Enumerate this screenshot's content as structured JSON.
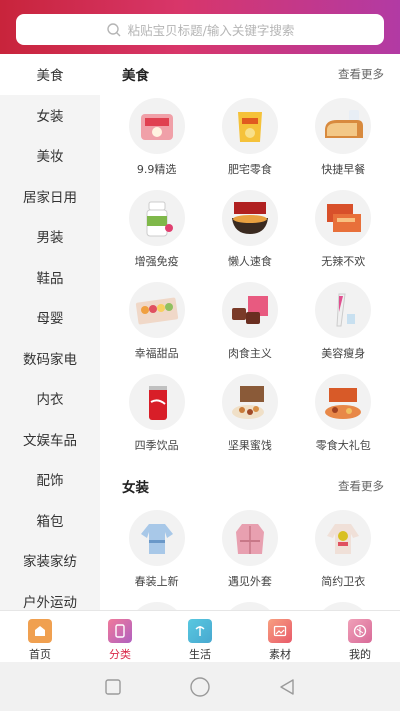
{
  "search": {
    "placeholder": "粘贴宝贝标题/输入关键字搜索"
  },
  "sidebar": {
    "items": [
      {
        "label": "美食",
        "active": true
      },
      {
        "label": "女装"
      },
      {
        "label": "美妆"
      },
      {
        "label": "居家日用"
      },
      {
        "label": "男装"
      },
      {
        "label": "鞋品"
      },
      {
        "label": "母婴"
      },
      {
        "label": "数码家电"
      },
      {
        "label": "内衣"
      },
      {
        "label": "文娱车品"
      },
      {
        "label": "配饰"
      },
      {
        "label": "箱包"
      },
      {
        "label": "家装家纺"
      },
      {
        "label": "户外运动"
      }
    ]
  },
  "sections": [
    {
      "title": "美食",
      "more": "查看更多",
      "items": [
        {
          "label": "9.9精选",
          "icon": "snack-bag-icon"
        },
        {
          "label": "肥宅零食",
          "icon": "chips-icon"
        },
        {
          "label": "快捷早餐",
          "icon": "bread-icon"
        },
        {
          "label": "增强免疫",
          "icon": "vitamin-bottle-icon"
        },
        {
          "label": "懒人速食",
          "icon": "noodle-bowl-icon"
        },
        {
          "label": "无辣不欢",
          "icon": "spicy-meat-icon"
        },
        {
          "label": "幸福甜品",
          "icon": "macaron-box-icon"
        },
        {
          "label": "肉食主义",
          "icon": "beef-jerky-icon"
        },
        {
          "label": "美容瘦身",
          "icon": "slim-drink-icon"
        },
        {
          "label": "四季饮品",
          "icon": "cola-can-icon"
        },
        {
          "label": "坚果蜜饯",
          "icon": "nuts-box-icon"
        },
        {
          "label": "零食大礼包",
          "icon": "gift-pack-icon"
        }
      ]
    },
    {
      "title": "女装",
      "more": "查看更多",
      "items": [
        {
          "label": "春装上新",
          "icon": "blouse-icon"
        },
        {
          "label": "遇见外套",
          "icon": "jacket-icon"
        },
        {
          "label": "简约卫衣",
          "icon": "sweatshirt-icon"
        }
      ]
    }
  ],
  "tabbar": {
    "items": [
      {
        "label": "首页",
        "icon": "home-icon",
        "color": "#f0a050"
      },
      {
        "label": "分类",
        "icon": "category-icon",
        "color": "#e05a8a",
        "active": true
      },
      {
        "label": "生活",
        "icon": "life-icon",
        "color": "#45b8d8"
      },
      {
        "label": "素材",
        "icon": "material-icon",
        "color": "#f06a6a"
      },
      {
        "label": "我的",
        "icon": "profile-icon",
        "color": "#e07aa0"
      }
    ]
  },
  "colors": {
    "accent": "#d9284a",
    "header_start": "#c8243b",
    "header_end": "#b23aa4"
  }
}
